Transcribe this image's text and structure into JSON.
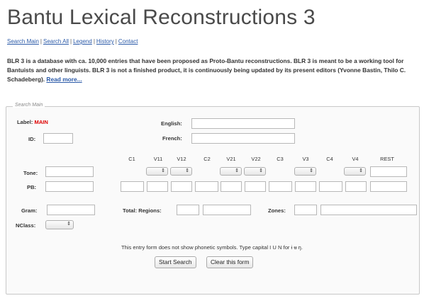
{
  "header": {
    "title": "Bantu Lexical Reconstructions 3"
  },
  "nav": {
    "items": [
      "Search Main",
      "Search All",
      "Legend",
      "History",
      "Contact"
    ],
    "separator": "|"
  },
  "intro": {
    "text": "BLR 3 is a database with ca. 10,000 entries that have been proposed as Proto-Bantu reconstructions. BLR 3 is meant to be a working tool for Bantuists and other linguists. BLR 3 is not a finished product, it is continuously being updated by its present editors (Yvonne Bastin, Thilo C. Schadeberg).",
    "read_more": "Read more..."
  },
  "form": {
    "legend": "Search Main",
    "label_prefix": "Label:",
    "label_value": "MAIN",
    "id_label": "ID:",
    "english_label": "English:",
    "french_label": "French:",
    "tone_label": "Tone:",
    "pb_label": "PB:",
    "gram_label": "Gram:",
    "nclass_label": "NClass:",
    "total_regions_label": "Total: Regions:",
    "zones_label": "Zones:",
    "columns": [
      "C1",
      "V11",
      "V12",
      "C2",
      "V21",
      "V22",
      "C3",
      "V3",
      "C4",
      "V4",
      "REST"
    ],
    "select_glyph": "⇕",
    "note": "This entry form does not show phonetic symbols. Type capital I U N for ɨ ʉ ŋ.",
    "start_button": "Start Search",
    "clear_button": "Clear this form"
  },
  "colors": {
    "link": "#2b5aa8",
    "label_red": "#dd0000",
    "title": "#4a4a4a"
  }
}
